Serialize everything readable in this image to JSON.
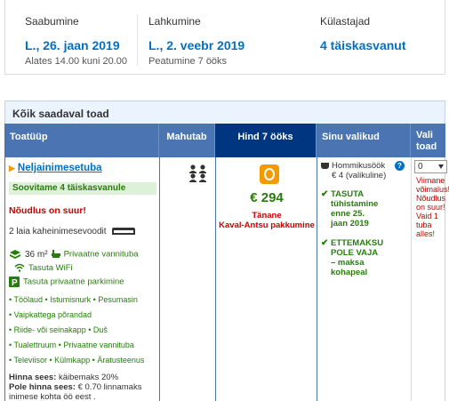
{
  "summary": {
    "checkin": {
      "label": "Saabumine",
      "date": "L., 26. jaan 2019",
      "sub": "Alates 14.00 kuni 20.00"
    },
    "checkout": {
      "label": "Lahkumine",
      "date": "L., 2. veebr 2019",
      "sub": "Peatumine 7 ööks"
    },
    "guests": {
      "label": "Külastajad",
      "value": "4 täiskasvanut"
    }
  },
  "panel": {
    "title": "Kõik saadaval toad"
  },
  "table": {
    "headers": {
      "type": "Toatüüp",
      "capacity": "Mahutab",
      "price": "Hind 7 ööks",
      "choices": "Sinu valikud",
      "select": "Vali toad"
    },
    "room": {
      "name": "Neljainimesetuba",
      "recommended": "Soovitame 4 täiskasvanule",
      "demand": "Nõudlus on suur!",
      "beds": "2 laia kaheinimesevoodit",
      "size": "36 m²",
      "bathroom": "Privaatne vannituba",
      "wifi": "Tasuta WiFi",
      "parking": "Tasuta privaatne parkimine",
      "amenities": [
        "• Töölaud  • Istumisnurk  • Pesumasin",
        "• Vaipkattega põrandad",
        "• Riide- või seinakapp  • Duš",
        "• Tualettruum  • Privaatne vannituba",
        "• Televiisor  • Külmkapp  • Äratusteenus"
      ],
      "price_includes_label": "Hinna sees:",
      "price_includes_value": "käibemaks 20%",
      "price_excludes_label": "Pole hinna sees:",
      "price_excludes_value": "€ 0.70 linnamaks",
      "price_excludes_extra": "inimese kohta öö eest ."
    },
    "price": {
      "amount": "€ 294",
      "deal_line1": "Tänane",
      "deal_line2": "Kaval-Antsu pakkumine"
    },
    "choices": {
      "breakfast_line1": "Hommikusöök",
      "breakfast_line2": "€ 4 (valikuline)",
      "info": "?",
      "free_cancel": [
        "TASUTA",
        "tühistamine",
        "enne 25.",
        "jaan 2019"
      ],
      "no_prepay": [
        "ETTEMAKSU",
        "POLE VAJA",
        "– maksa",
        "kohapeal"
      ]
    },
    "select": {
      "value": "0",
      "last_rooms": [
        "Viimane",
        "võimalus!",
        "Nõudlus",
        "on suur!",
        "Vaid 1",
        "tuba",
        "alles!"
      ]
    }
  },
  "colors": {
    "link": "#0071c2",
    "header_bg": "#4b75b2",
    "header_price_bg": "#003580",
    "green": "#267d0c",
    "red": "#cc0000",
    "deal_orange": "#f29b00"
  }
}
